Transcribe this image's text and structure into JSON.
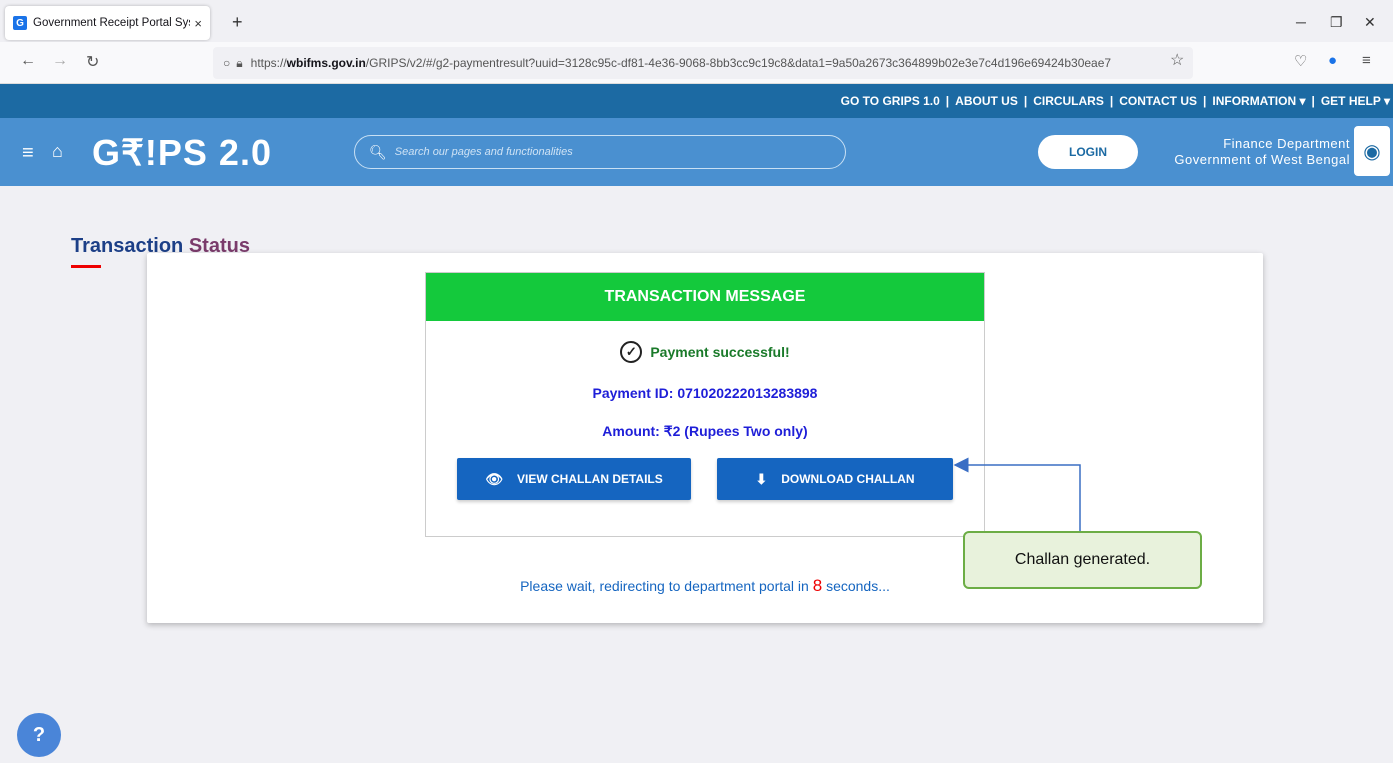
{
  "browser": {
    "tab_title": "Government Receipt Portal Syst",
    "tab_favicon": "G",
    "tab_close": "×",
    "new_tab": "+",
    "url_prefix": "https://",
    "url_domain": "wbifms.gov.in",
    "url_path": "/GRIPS/v2/#/g2-paymentresult?uuid=3128c95c-df81-4e36-9068-8bb3cc9c19c8&data1=9a50a2673c364899b02e3e7c4d196e69424b30eae7"
  },
  "topnav": {
    "links": [
      "GO TO GRIPS 1.0",
      "ABOUT US",
      "CIRCULARS",
      "CONTACT US",
      "INFORMATION ▾",
      "GET HELP ▾"
    ],
    "separator": "|"
  },
  "header": {
    "logo": "G₹!PS 2.0",
    "search_placeholder": "Search our pages and functionalities",
    "login_label": "LOGIN",
    "dept_line1": "Finance Department",
    "dept_line2": "Government of West Bengal"
  },
  "page": {
    "title_part1": "Transaction",
    "title_part2": "Status"
  },
  "transaction": {
    "header": "TRANSACTION MESSAGE",
    "success_text": "Payment successful!",
    "payment_id": "Payment ID: 071020222013283898",
    "amount": "Amount: ₹2 (Rupees Two only)",
    "view_label": "VIEW CHALLAN DETAILS",
    "download_label": "DOWNLOAD CHALLAN",
    "redirect_prefix": "Please wait, redirecting to department portal in",
    "redirect_count": "8",
    "redirect_suffix": "seconds..."
  },
  "annotation": {
    "callout_text": "Challan generated.",
    "border_color": "#6cad45",
    "fill_color": "#e8f2dc"
  },
  "colors": {
    "brand_dark": "#1c6aa3",
    "brand_light": "#4a90d0",
    "success_green": "#14c93c",
    "button_blue": "#1565c0"
  }
}
